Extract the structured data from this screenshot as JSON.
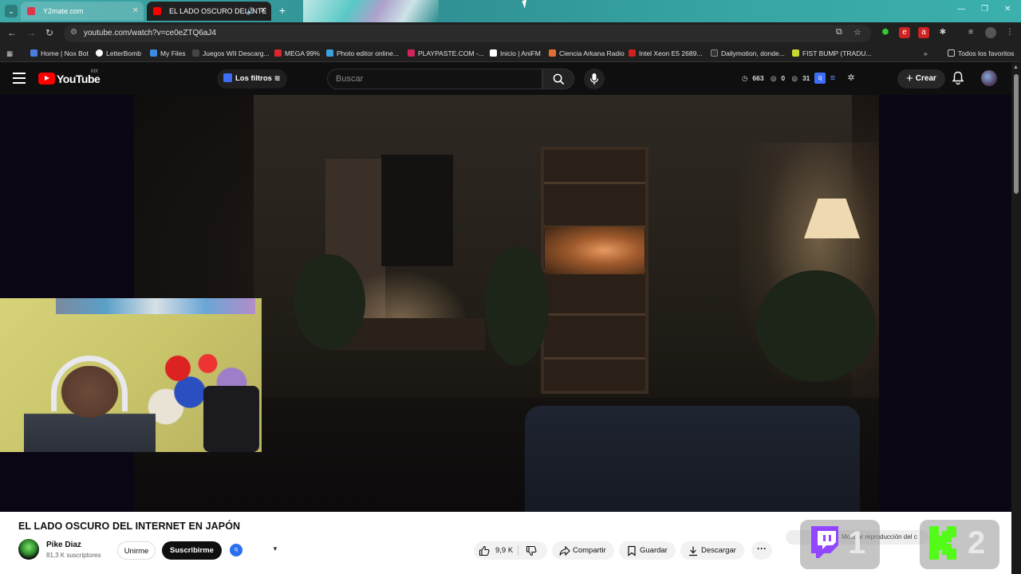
{
  "browser": {
    "tabs": [
      {
        "title": "Y2mate.com",
        "color": "#e0344a"
      },
      {
        "title": "EL LADO OSCURO DEL INTE",
        "color": "#ff0000"
      }
    ],
    "url": "youtube.com/watch?v=ce0eZTQ6aJ4",
    "bookmarks": [
      {
        "label": "Home | Nox Bot",
        "color": "#4a7de0"
      },
      {
        "label": "LetterBomb",
        "color": "#ffffff"
      },
      {
        "label": "My Files",
        "color": "#3d8be0"
      },
      {
        "label": "Juegos WII Descarg...",
        "color": "#444444"
      },
      {
        "label": "MEGA 99%",
        "color": "#d9272e"
      },
      {
        "label": "Photo editor online...",
        "color": "#3da0e0"
      },
      {
        "label": "PLAYPASTE.COM -...",
        "color": "#d0245a"
      },
      {
        "label": "Inicio | AniFM",
        "color": "#ffffff"
      },
      {
        "label": "Ciencia Arkana Radio",
        "color": "#e07030"
      },
      {
        "label": "Intel Xeon E5 2689...",
        "color": "#d02020"
      },
      {
        "label": "Dailymotion, donde...",
        "color": "#333333"
      },
      {
        "label": "FIST BUMP (TRADU...",
        "color": "#c8d830"
      }
    ],
    "favorites_label": "Todos los favoritos"
  },
  "youtube": {
    "logo_text": "YouTube",
    "country": "MX",
    "filters_label": "Los filtros",
    "search_placeholder": "Buscar",
    "stats": {
      "a": "663",
      "b": "0",
      "c": "31"
    },
    "create_label": "Crear"
  },
  "video": {
    "title": "EL LADO OSCURO DEL INTERNET EN JAPÓN",
    "channel": "Pike Diaz",
    "subscribers": "81,3 K suscriptores",
    "join_label": "Unirme",
    "subscribe_label": "Suscribirme",
    "likes": "9,9 K",
    "share_label": "Compartir",
    "save_label": "Guardar",
    "download_label": "Descargar",
    "autoplay_text": "Mostrar reproducción del c"
  },
  "overlays": {
    "twitch_number": "1",
    "kick_number": "2"
  }
}
